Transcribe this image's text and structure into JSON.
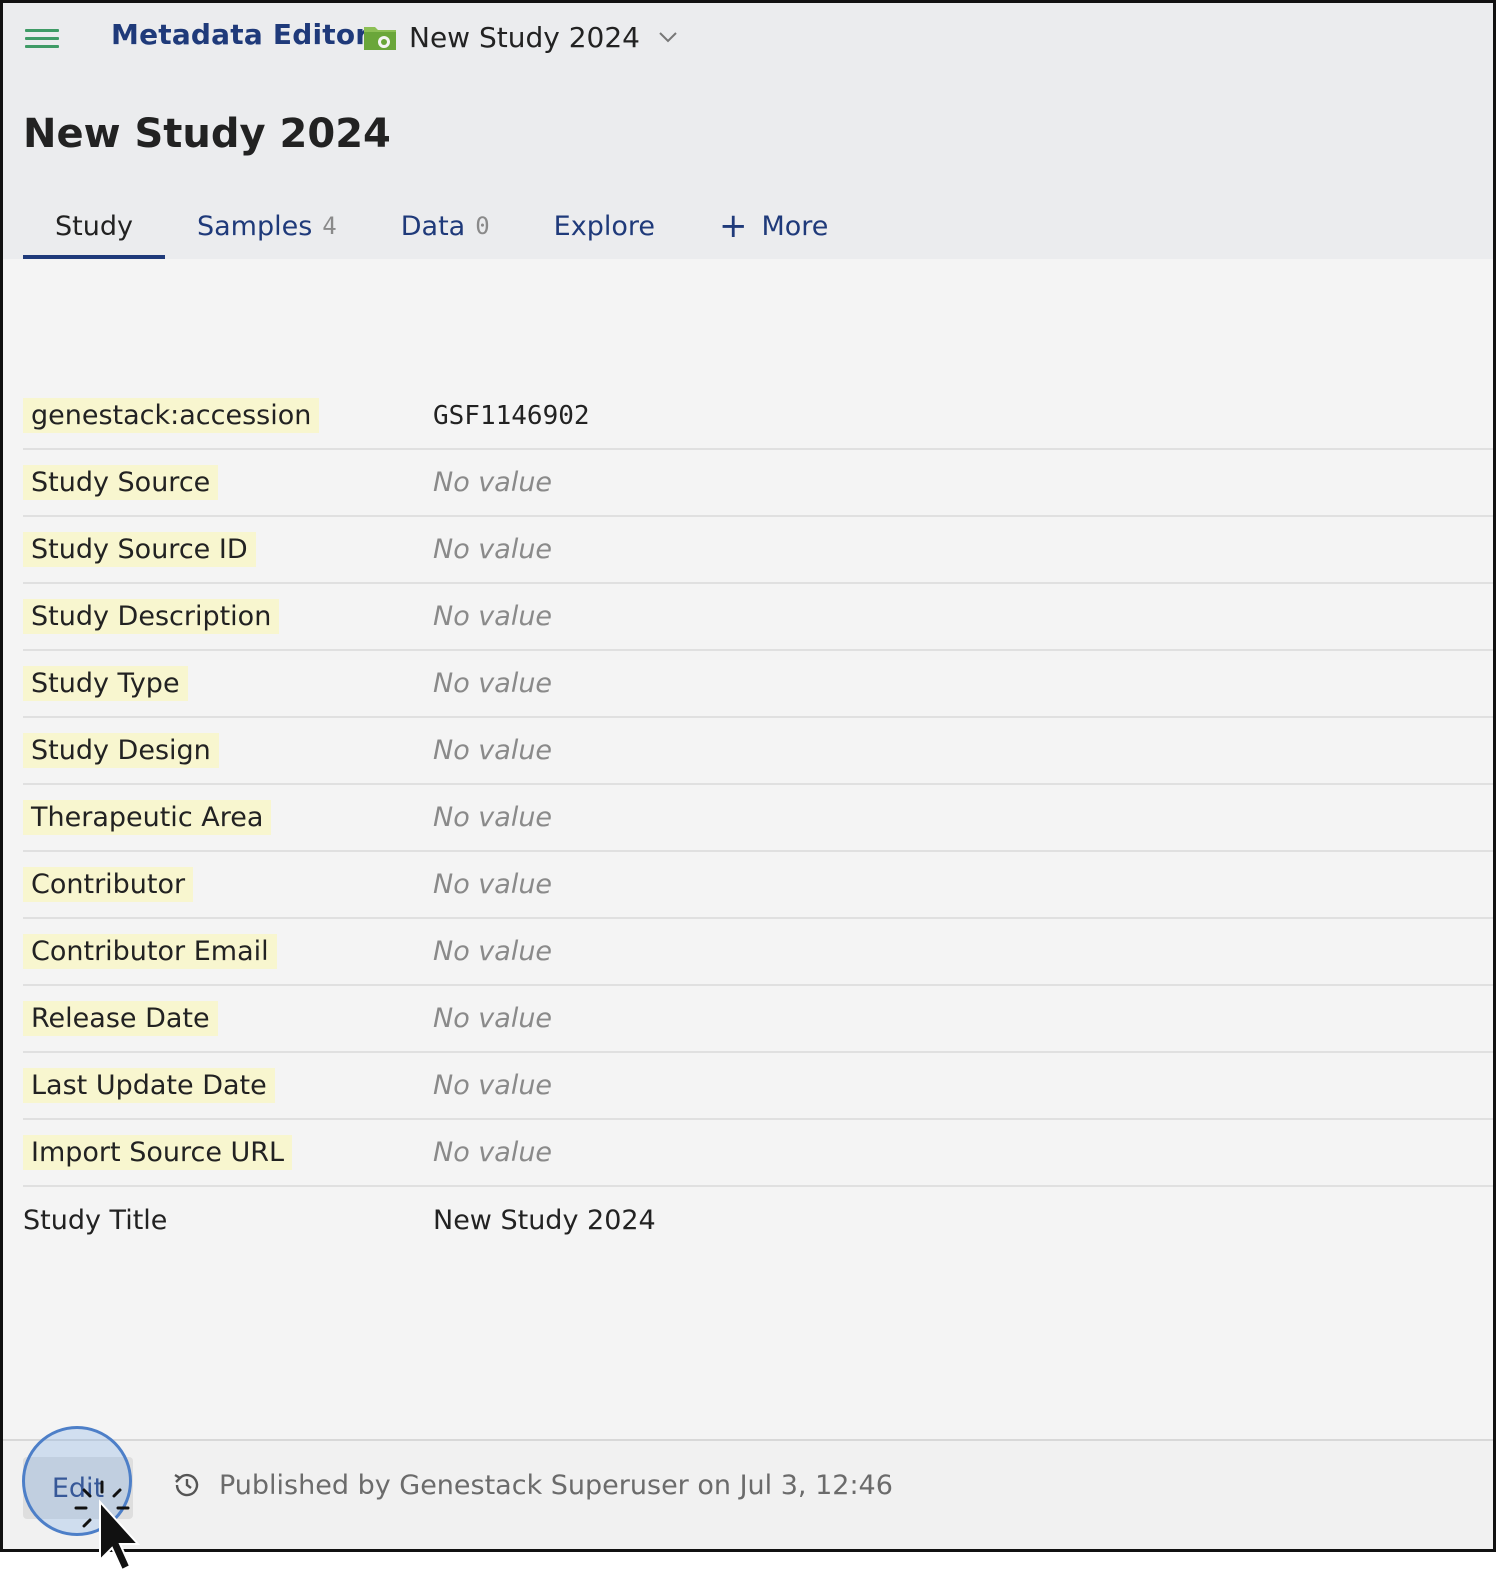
{
  "header": {
    "app_title": "Metadata Editor",
    "study_picker": {
      "name": "New Study 2024",
      "icon": "folder-icon"
    },
    "menu_icon": "hamburger-icon"
  },
  "page": {
    "title": "New Study 2024"
  },
  "tabs": [
    {
      "label": "Study",
      "count": "",
      "active": true
    },
    {
      "label": "Samples",
      "count": "4"
    },
    {
      "label": "Data",
      "count": "0"
    },
    {
      "label": "Explore",
      "count": ""
    },
    {
      "label": "More",
      "icon": "plus-icon"
    }
  ],
  "metadata": {
    "rows": [
      {
        "key": "genestack:accession",
        "value": "GSF1146902"
      },
      {
        "key": "Study Source",
        "value": "No value"
      },
      {
        "key": "Study Source ID",
        "value": "No value"
      },
      {
        "key": "Study Description",
        "value": "No value"
      },
      {
        "key": "Study Type",
        "value": "No value"
      },
      {
        "key": "Study Design",
        "value": "No value"
      },
      {
        "key": "Therapeutic Area",
        "value": "No value"
      },
      {
        "key": "Contributor",
        "value": "No value"
      },
      {
        "key": "Contributor Email",
        "value": "No value"
      },
      {
        "key": "Release Date",
        "value": "No value"
      },
      {
        "key": "Last Update Date",
        "value": "No value"
      },
      {
        "key": "Import Source URL",
        "value": "No value"
      },
      {
        "key": "Study Title",
        "value": "New Study 2024"
      }
    ]
  },
  "footer": {
    "edit_label": "Edit",
    "status": "Published by Genestack Superuser on Jul 3, 12:46",
    "status_icon": "history-icon"
  },
  "colors": {
    "accent": "#1f3a7a",
    "menu_green": "#3f9b66",
    "key_highlight": "#f8f6cf",
    "header_bg": "#ebecee",
    "content_bg": "#f4f4f4"
  }
}
